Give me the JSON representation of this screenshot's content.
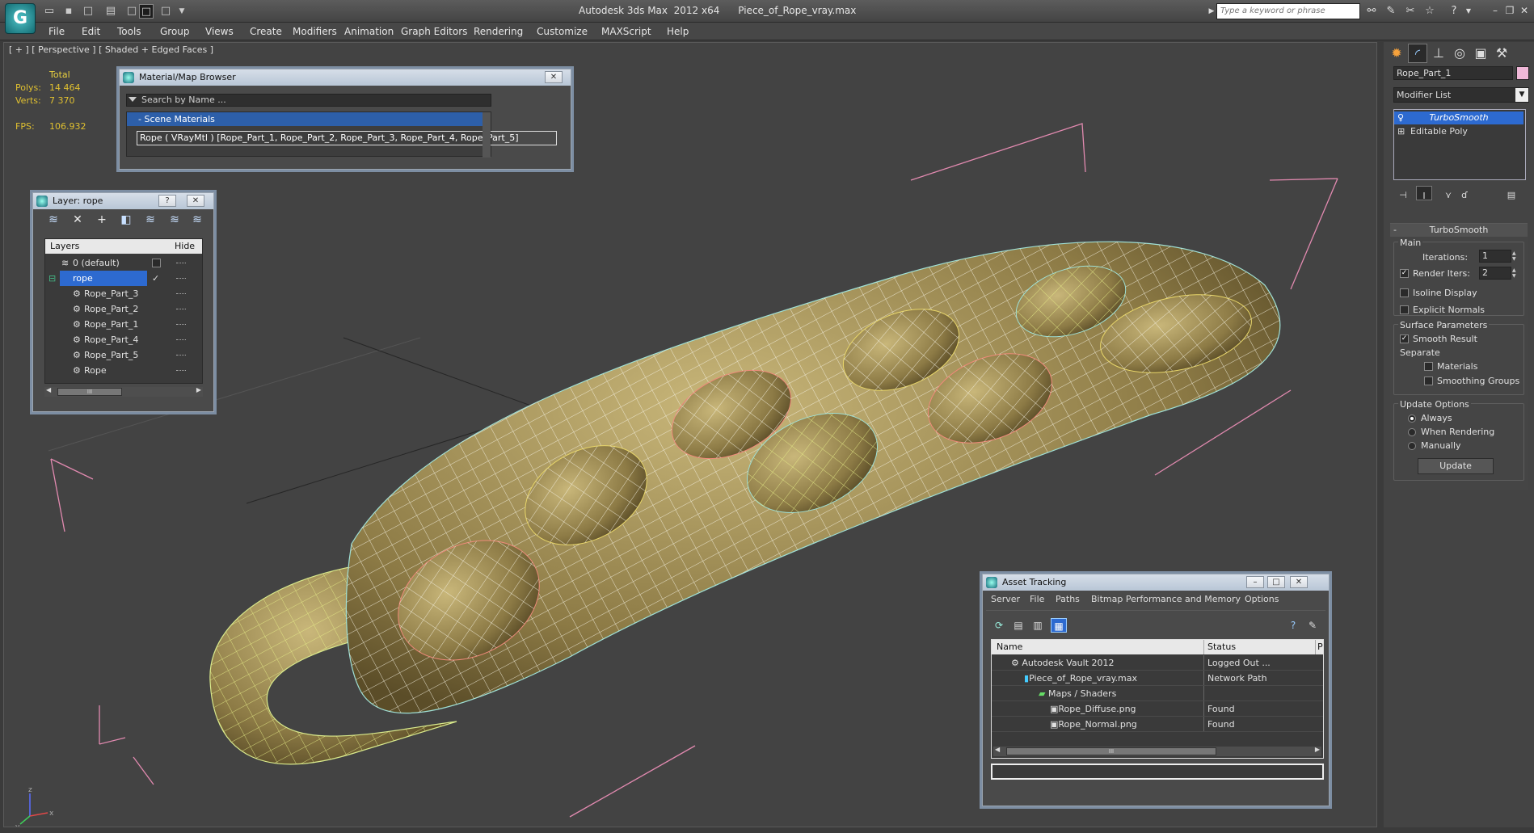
{
  "app": {
    "title": "Autodesk 3ds Max  2012 x64",
    "file": "Piece_of_Rope_vray.max",
    "search_placeholder": "Type a keyword or phrase",
    "logo": "G"
  },
  "menus": [
    "File",
    "Edit",
    "Tools",
    "Group",
    "Views",
    "Create",
    "Modifiers",
    "Animation",
    "Graph Editors",
    "Rendering",
    "Customize",
    "MAXScript",
    "Help"
  ],
  "viewport": {
    "label": "[ + ] [ Perspective ] [ Shaded + Edged Faces ]",
    "stats": {
      "header": "Total",
      "polys_label": "Polys:",
      "polys": "14 464",
      "verts_label": "Verts:",
      "verts": "7 370",
      "fps_label": "FPS:",
      "fps": "106.932"
    },
    "axis": {
      "x": "x",
      "y": "y",
      "z": "z"
    }
  },
  "material_browser": {
    "title": "Material/Map Browser",
    "search_placeholder": "Search by Name ...",
    "category": "- Scene Materials",
    "item": "Rope  ( VRayMtl )  [Rope_Part_1, Rope_Part_2, Rope_Part_3, Rope_Part_4, Rope_Part_5]",
    "close": "✕"
  },
  "layer_panel": {
    "title": "Layer: rope",
    "help": "?",
    "close": "✕",
    "headers": {
      "layers": "Layers",
      "hide": "Hide"
    },
    "rows": [
      {
        "name": "0 (default)"
      },
      {
        "name": "rope"
      },
      {
        "name": "Rope_Part_3"
      },
      {
        "name": "Rope_Part_2"
      },
      {
        "name": "Rope_Part_1"
      },
      {
        "name": "Rope_Part_4"
      },
      {
        "name": "Rope_Part_5"
      },
      {
        "name": "Rope"
      }
    ],
    "scroll_grip": "III"
  },
  "command_panel": {
    "object_name": "Rope_Part_1",
    "object_color": "#f0b8d8",
    "modifier_list": "Modifier List",
    "stack": [
      "TurboSmooth",
      "Editable Poly"
    ],
    "rollout": "TurboSmooth",
    "main": "Main",
    "iterations_label": "Iterations:",
    "iterations": "1",
    "render_iters_label": "Render Iters:",
    "render_iters": "2",
    "isoline": "Isoline Display",
    "explicit_normals": "Explicit Normals",
    "surface_params": "Surface Parameters",
    "smooth_result": "Smooth Result",
    "separate": "Separate",
    "materials": "Materials",
    "smoothing_groups": "Smoothing Groups",
    "update_options": "Update Options",
    "always": "Always",
    "when_rendering": "When Rendering",
    "manually": "Manually",
    "update_btn": "Update"
  },
  "asset_tracking": {
    "title": "Asset Tracking",
    "menus": [
      "Server",
      "File",
      "Paths",
      "Bitmap Performance and Memory",
      "Options"
    ],
    "headers": {
      "name": "Name",
      "status": "Status",
      "p": "P"
    },
    "rows": [
      {
        "name": "Autodesk Vault 2012",
        "status": "Logged Out ..."
      },
      {
        "name": "Piece_of_Rope_vray.max",
        "status": "Network Path"
      },
      {
        "name": "Maps / Shaders",
        "status": ""
      },
      {
        "name": "Rope_Diffuse.png",
        "status": "Found"
      },
      {
        "name": "Rope_Normal.png",
        "status": "Found"
      }
    ],
    "scroll_grip": "III",
    "help": "?"
  },
  "colors": {
    "accent": "#2d6ad0",
    "selection": "#2d5fa9",
    "stats": "#e0c030"
  }
}
